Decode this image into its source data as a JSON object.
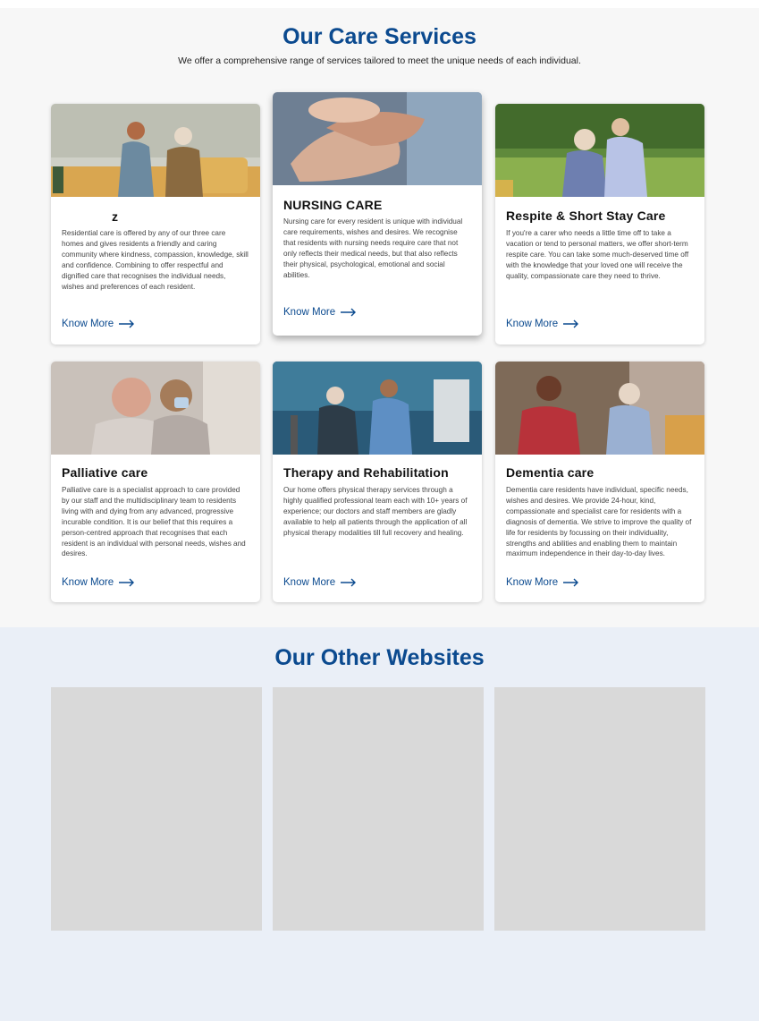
{
  "services_section": {
    "title": "Our Care Services",
    "subtitle": "We offer a comprehensive range of services tailored to meet the unique needs of each individual."
  },
  "cards": [
    {
      "title": "z",
      "description": "Residential care is offered by any of our three care homes and gives residents a friendly and caring community where kindness, compassion, knowledge, skill and confidence. Combining to offer respectful and dignified care that recognises the individual needs, wishes and preferences of each resident.",
      "link_label": "Know More",
      "image": "photo-carer-with-elderly-man"
    },
    {
      "title": "NURSING CARE",
      "description": "Nursing care for every resident is unique with individual care requirements, wishes and desires. We recognise that residents with nursing needs require care that not only reflects their medical needs, but that also reflects their physical, psychological, emotional and social abilities.",
      "link_label": "Know More",
      "image": "photo-holding-hands"
    },
    {
      "title": "Respite & Short Stay Care",
      "description": "If you're a carer who needs a little time off to take a vacation or tend to personal matters, we offer short-term respite care. You can take some much-deserved time off with the knowledge that your loved one will receive the quality, compassionate care they need to thrive.",
      "link_label": "Know More",
      "image": "photo-nurse-hugging-elderly-man"
    },
    {
      "title": "Palliative care",
      "description": "Palliative care is a specialist approach to care provided by our staff and the multidisciplinary team to residents living with and dying from any advanced, progressive incurable condition. It is our belief that this requires a person-centred approach that recognises that each resident is an individual with personal needs, wishes and desires.",
      "link_label": "Know More",
      "image": "photo-two-women-comforting"
    },
    {
      "title": "Therapy and Rehabilitation",
      "description": "Our home offers physical therapy services through a highly qualified professional team each with 10+ years of experience; our doctors and staff members are gladly available to help all patients through the application of all physical therapy modalities till full recovery and healing.",
      "link_label": "Know More",
      "image": "photo-therapist-with-wheelchair-patient"
    },
    {
      "title": "Dementia care",
      "description": "Dementia care residents have individual, specific needs, wishes and desires. We provide 24-hour, kind, compassionate and specialist care for residents with a diagnosis of dementia. We strive to improve the quality of life for residents by focussing on their individuality, strengths and abilities and enabling them to maintain maximum independence in their day-to-day lives.",
      "link_label": "Know More",
      "image": "photo-family-with-elderly-man"
    }
  ],
  "other_websites": {
    "title": "Our Other Websites"
  },
  "colors": {
    "brand_blue": "#0b4a8f",
    "section_bg": "#f7f7f7",
    "other_bg": "#eaeff7",
    "placeholder": "#d9d9d9"
  }
}
